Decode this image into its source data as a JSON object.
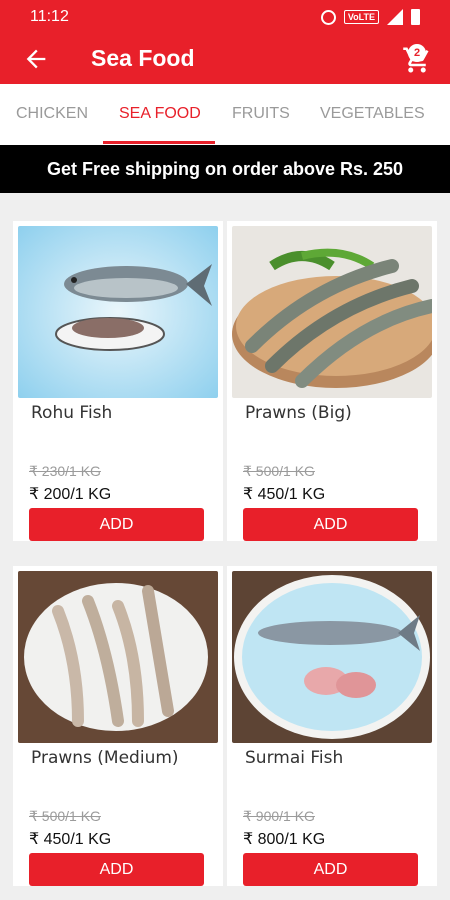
{
  "status_bar": {
    "time": "11:12",
    "network_badge": "VoLTE"
  },
  "header": {
    "title": "Sea Food",
    "cart_count": "2"
  },
  "tabs": [
    {
      "label": "CHICKEN",
      "active": false
    },
    {
      "label": "SEA FOOD",
      "active": true
    },
    {
      "label": "FRUITS",
      "active": false
    },
    {
      "label": "VEGETABLES",
      "active": false
    }
  ],
  "banner": "Get Free shipping on order above Rs. 250",
  "products": [
    {
      "name": "Rohu Fish",
      "mrp": "₹ 230/1 KG",
      "price": "₹ 200/1 KG",
      "add_label": "ADD"
    },
    {
      "name": "Prawns (Big)",
      "mrp": "₹ 500/1 KG",
      "price": "₹ 450/1 KG",
      "add_label": "ADD"
    },
    {
      "name": "Prawns (Medium)",
      "mrp": "₹ 500/1 KG",
      "price": "₹ 450/1 KG",
      "add_label": "ADD"
    },
    {
      "name": "Surmai Fish",
      "mrp": "₹ 900/1 KG",
      "price": "₹ 800/1 KG",
      "add_label": "ADD"
    }
  ],
  "colors": {
    "brand": "#e8202a",
    "banner_bg": "#000000",
    "tab_inactive": "#9a9a9a"
  },
  "icons": {
    "back": "arrow-left-icon",
    "cart": "shopping-cart-icon"
  }
}
